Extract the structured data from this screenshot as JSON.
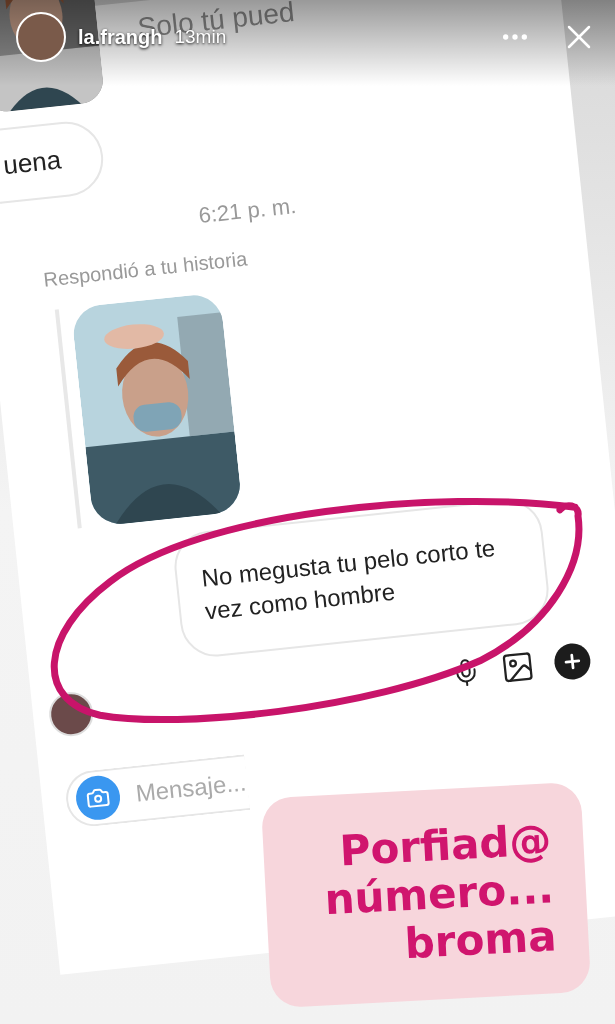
{
  "story_header": {
    "username": "la.frangh",
    "time": "13min"
  },
  "chat": {
    "notice": "Solo tú pued",
    "messages": [
      {
        "kind": "received",
        "text": "uena"
      },
      {
        "kind": "time",
        "text": "6:21 p. m."
      },
      {
        "kind": "reply_label",
        "text": "Respondió a tu historia"
      },
      {
        "kind": "story"
      },
      {
        "kind": "sent",
        "text": "No megusta tu pelo corto te vez  como hombre"
      }
    ],
    "composer": {
      "placeholder": "Mensaje..."
    }
  },
  "sticker": {
    "lines": [
      "Porfiad@",
      "número...",
      "broma"
    ]
  }
}
